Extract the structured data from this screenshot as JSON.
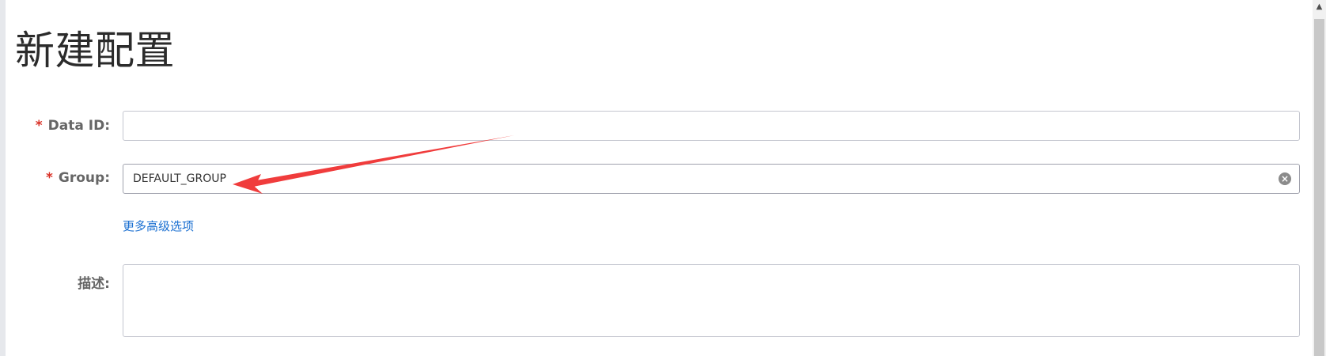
{
  "page": {
    "title": "新建配置"
  },
  "form": {
    "data_id": {
      "required_mark": "*",
      "label": "Data ID:",
      "value": "",
      "placeholder": ""
    },
    "group": {
      "required_mark": "*",
      "label": "Group:",
      "value": "DEFAULT_GROUP",
      "clear_icon": "close-circle-icon"
    },
    "advanced_link": {
      "label": "更多高级选项"
    },
    "description": {
      "label": "描述:",
      "value": ""
    }
  },
  "annotation": {
    "arrow_color": "#f03c3c"
  },
  "colors": {
    "required": "#d93026",
    "link": "#1a6fd1",
    "label": "#666666",
    "border": "#c4c6cf"
  }
}
